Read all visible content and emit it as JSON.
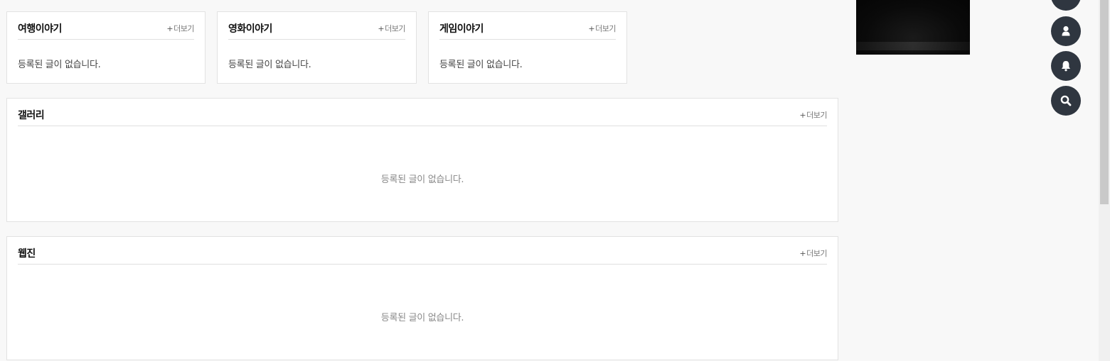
{
  "small_boards": [
    {
      "title": "여행이야기",
      "more": "더보기",
      "empty": "등록된 글이 없습니다."
    },
    {
      "title": "영화이야기",
      "more": "더보기",
      "empty": "등록된 글이 없습니다."
    },
    {
      "title": "게임이야기",
      "more": "더보기",
      "empty": "등록된 글이 없습니다."
    }
  ],
  "gallery": {
    "title": "갤러리",
    "more": "더보기",
    "empty": "등록된 글이 없습니다."
  },
  "webzine": {
    "title": "웹진",
    "more": "더보기",
    "empty": "등록된 글이 없습니다."
  },
  "more_plus": "+",
  "quick_menu": [
    {
      "icon": "menu-icon"
    },
    {
      "icon": "user-icon"
    },
    {
      "icon": "bell-icon"
    },
    {
      "icon": "search-icon"
    }
  ],
  "colors": {
    "quick_button": "#2f3640",
    "board_border": "#e2e2e2",
    "background": "#f8f8f8"
  }
}
